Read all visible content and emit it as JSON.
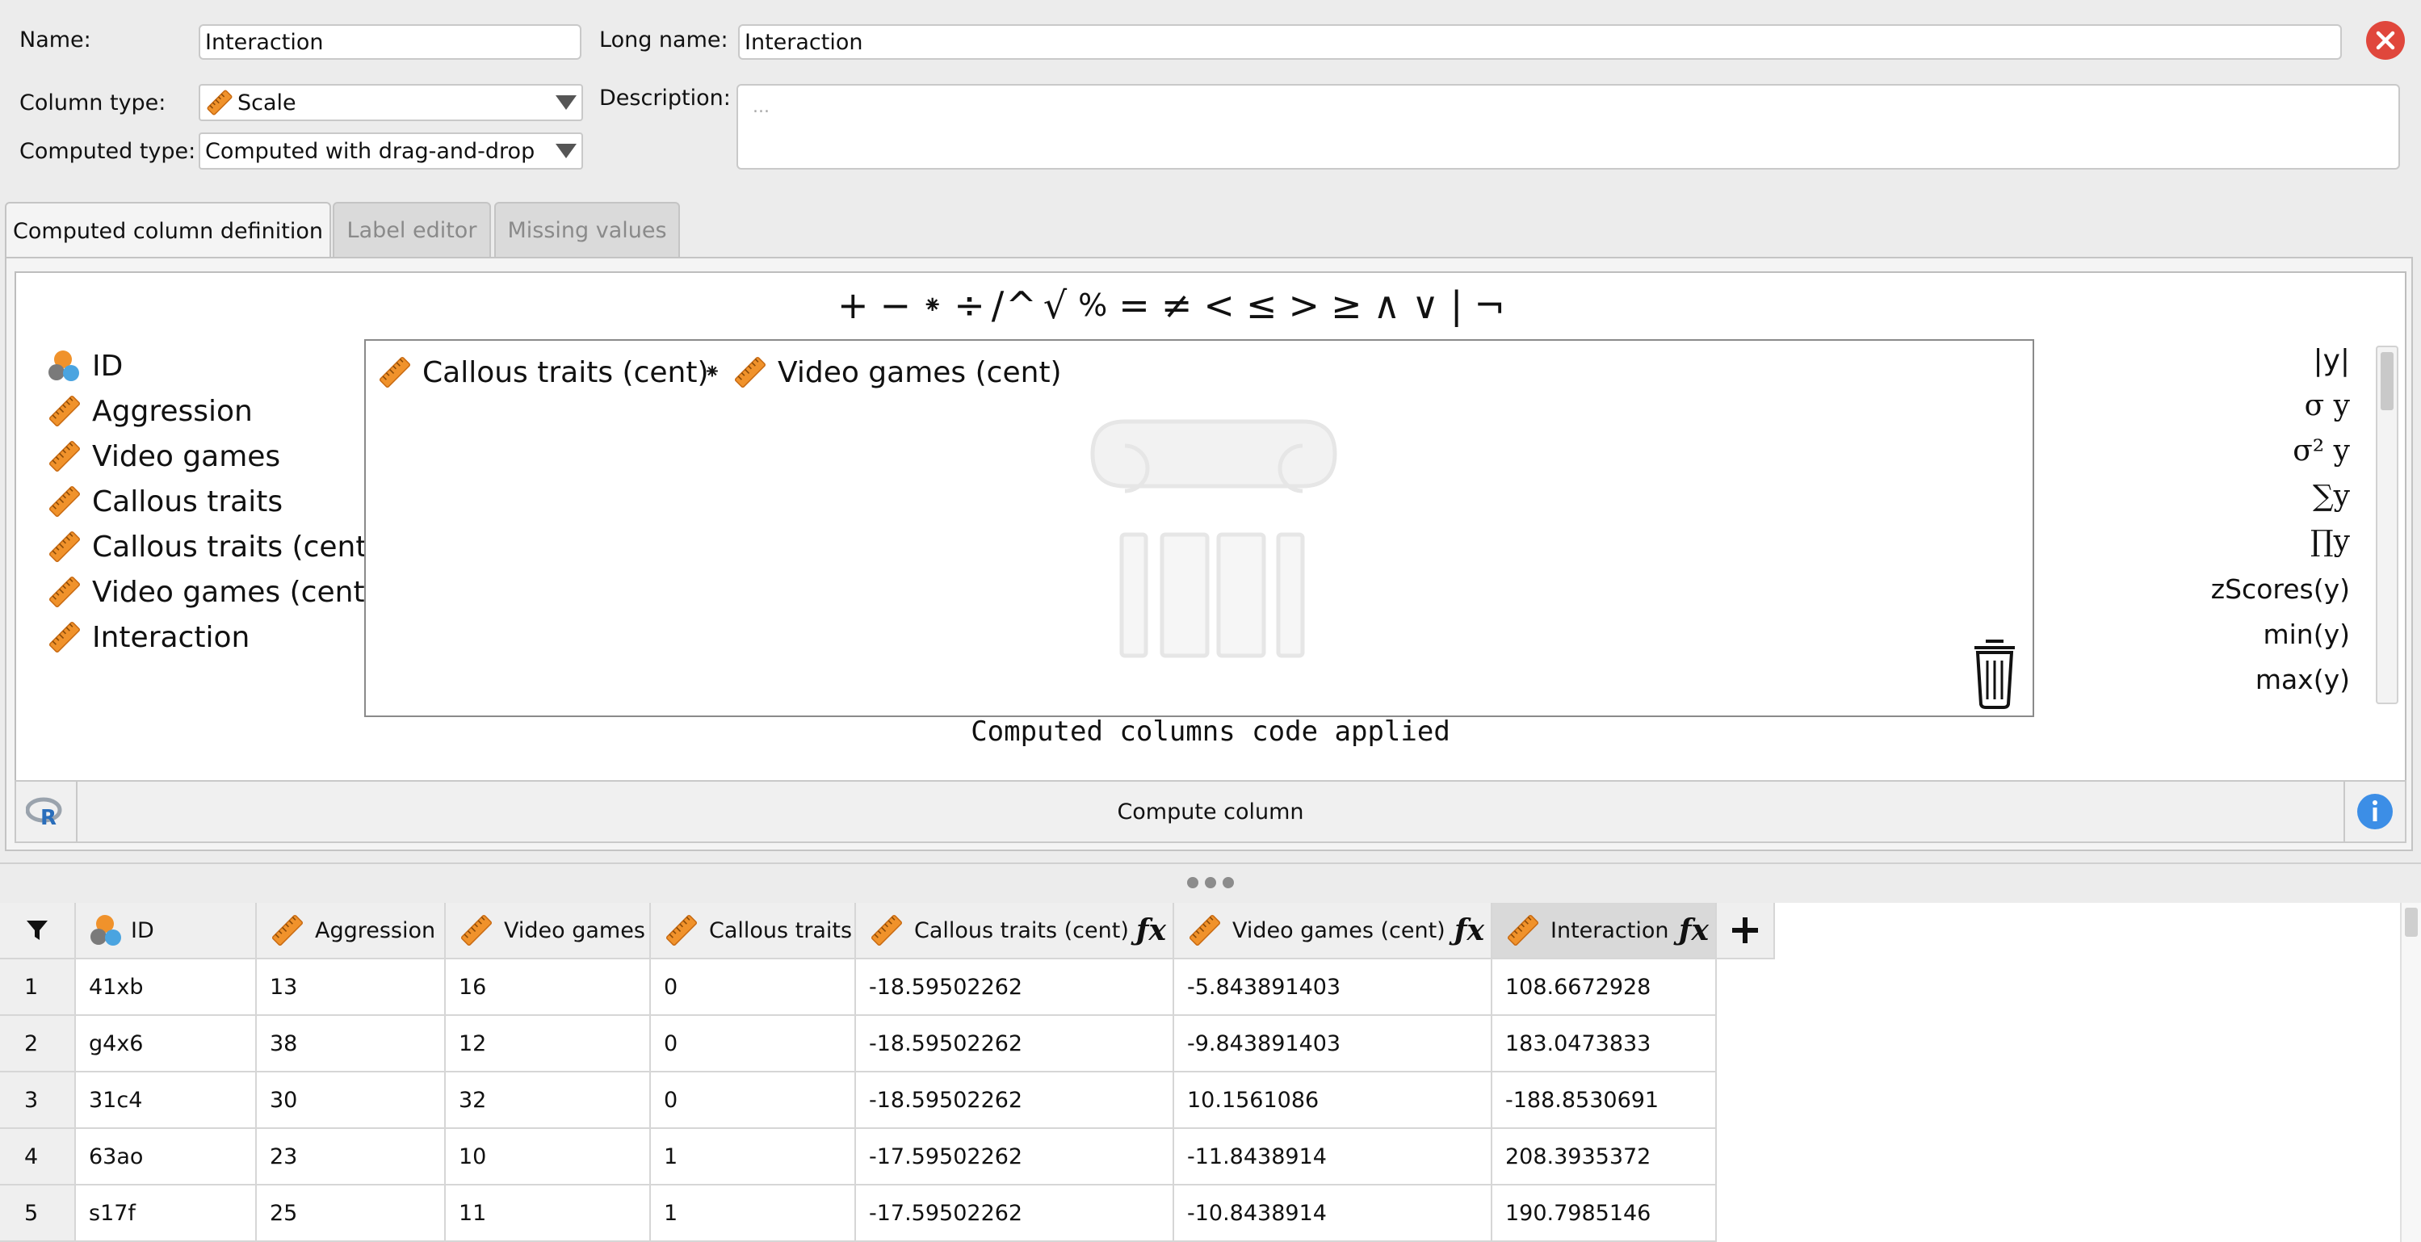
{
  "form": {
    "name_label": "Name:",
    "name_value": "Interaction",
    "long_name_label": "Long name:",
    "long_name_value": "Interaction",
    "column_type_label": "Column type:",
    "column_type_value": "Scale",
    "computed_type_label": "Computed type:",
    "computed_type_value": "Computed with drag-and-drop",
    "description_label": "Description:",
    "description_placeholder": "..."
  },
  "tabs": [
    {
      "label": "Computed column definition",
      "active": true
    },
    {
      "label": "Label editor",
      "active": false
    },
    {
      "label": "Missing values",
      "active": false
    }
  ],
  "operators": [
    "+",
    "−",
    "⁕",
    "÷",
    "/",
    "^",
    "√",
    "%",
    "=",
    "≠",
    "<",
    "≤",
    ">",
    "≥",
    "∧",
    "∨",
    "|",
    "¬"
  ],
  "variables": [
    {
      "label": "ID",
      "icon": "nominal-text-icon"
    },
    {
      "label": "Aggression",
      "icon": "scale-ruler-icon"
    },
    {
      "label": "Video games",
      "icon": "scale-ruler-icon"
    },
    {
      "label": "Callous traits",
      "icon": "scale-ruler-icon"
    },
    {
      "label": "Callous traits (cent)",
      "icon": "scale-ruler-icon"
    },
    {
      "label": "Video games (cent)",
      "icon": "scale-ruler-icon"
    },
    {
      "label": "Interaction",
      "icon": "scale-ruler-icon"
    }
  ],
  "formula": {
    "left_operand": "Callous traits (cent)",
    "operator": "⁕",
    "right_operand": "Video games (cent)"
  },
  "functions": [
    "|y|",
    "σ y",
    "σ² y",
    "∑y",
    "∏y",
    "zScores(y)",
    "min(y)",
    "max(y)"
  ],
  "status_message": "Computed columns code applied",
  "compute_button_label": "Compute column",
  "table": {
    "columns": [
      "ID",
      "Aggression",
      "Video games",
      "Callous traits",
      "Callous traits (cent)",
      "Video games (cent)",
      "Interaction"
    ],
    "rows": [
      {
        "n": "1",
        "cells": [
          "41xb",
          "13",
          "16",
          "0",
          "-18.59502262",
          "-5.843891403",
          "108.6672928"
        ]
      },
      {
        "n": "2",
        "cells": [
          "g4x6",
          "38",
          "12",
          "0",
          "-18.59502262",
          "-9.843891403",
          "183.0473833"
        ]
      },
      {
        "n": "3",
        "cells": [
          "31c4",
          "30",
          "32",
          "0",
          "-18.59502262",
          "10.1561086",
          "-188.8530691"
        ]
      },
      {
        "n": "4",
        "cells": [
          "63ao",
          "23",
          "10",
          "1",
          "-17.59502262",
          "-11.8438914",
          "208.3935372"
        ]
      },
      {
        "n": "5",
        "cells": [
          "s17f",
          "25",
          "11",
          "1",
          "-17.59502262",
          "-10.8438914",
          "190.7985146"
        ]
      }
    ]
  },
  "colors": {
    "accent_close": "#e0473c",
    "accent_info": "#3c8ee6",
    "scale_icon": "#f0922b"
  }
}
